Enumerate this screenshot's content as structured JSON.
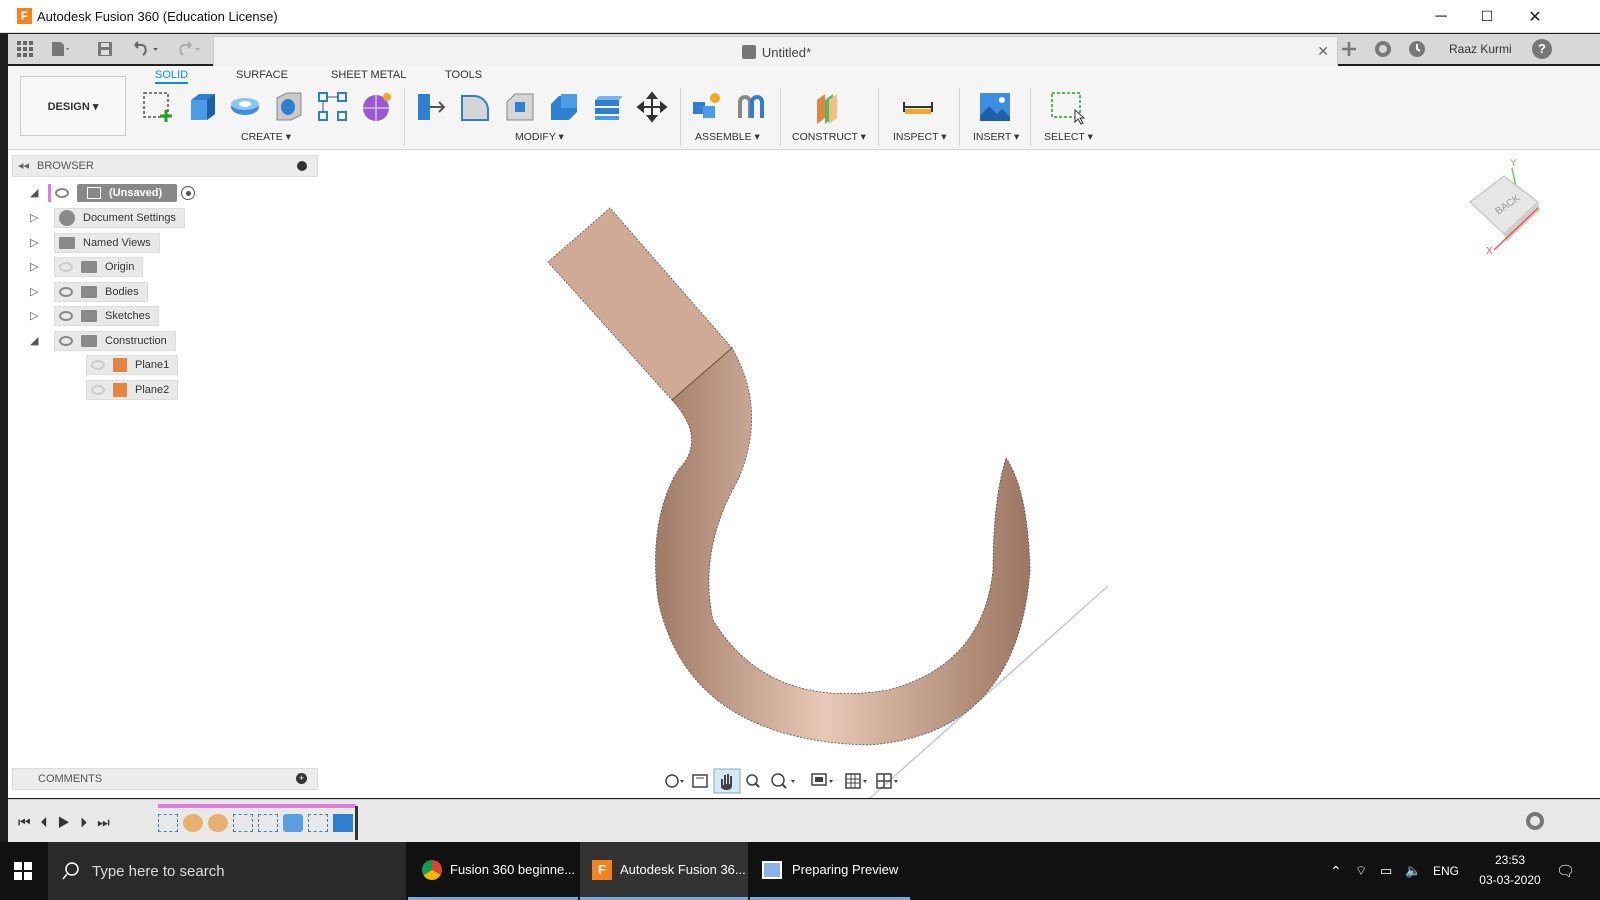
{
  "window": {
    "title": "Autodesk Fusion 360 (Education License)",
    "logo_letter": "F",
    "minimize": "─",
    "maximize": "☐",
    "close": "✕"
  },
  "appbar": {
    "doc_tab": "Untitled*",
    "user": "Raaz Kurmi",
    "help": "?"
  },
  "ribbon": {
    "workspace": "DESIGN ▾",
    "tabs": [
      "SOLID",
      "SURFACE",
      "SHEET METAL",
      "TOOLS"
    ],
    "groups": {
      "create": "CREATE ▾",
      "modify": "MODIFY ▾",
      "assemble": "ASSEMBLE ▾",
      "construct": "CONSTRUCT ▾",
      "inspect": "INSPECT ▾",
      "insert": "INSERT ▾",
      "select": "SELECT ▾"
    }
  },
  "browser": {
    "header": "BROWSER",
    "root": "(Unsaved)",
    "items": [
      {
        "label": "Document Settings",
        "icon": "gear-icon"
      },
      {
        "label": "Named Views",
        "icon": "folder-icon"
      },
      {
        "label": "Origin",
        "icon": "folder-icon"
      },
      {
        "label": "Bodies",
        "icon": "folder-icon"
      },
      {
        "label": "Sketches",
        "icon": "folder-icon"
      },
      {
        "label": "Construction",
        "icon": "folder-icon"
      }
    ],
    "construction_children": [
      "Plane1",
      "Plane2"
    ]
  },
  "comments": {
    "header": "COMMENTS"
  },
  "viewcube": {
    "face": "BACK",
    "axis_y": "Y",
    "axis_x": "X"
  },
  "taskbar": {
    "search_placeholder": "Type here to search",
    "apps": [
      "Fusion 360 beginne...",
      "Autodesk Fusion 36...",
      "Preparing Preview"
    ],
    "language": "ENG",
    "time": "23:53",
    "date": "03-03-2020"
  },
  "colors": {
    "accent": "#0696d7",
    "hook": "#caa08a",
    "timeline_bar": "#e27be0"
  }
}
